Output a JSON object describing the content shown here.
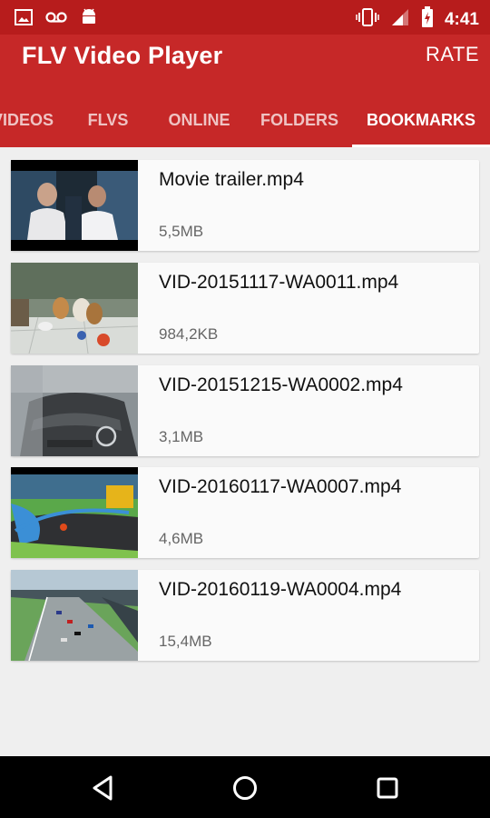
{
  "status_bar": {
    "time": "4:41",
    "left_icons": [
      "image-icon",
      "voicemail-icon",
      "android-icon"
    ],
    "right_icons": [
      "vibrate-icon",
      "signal-icon",
      "battery-charging-icon"
    ]
  },
  "app_bar": {
    "title": "FLV Video Player",
    "action_label": "RATE"
  },
  "tabs": [
    {
      "label": "VIDEOS",
      "active": false
    },
    {
      "label": "FLVS",
      "active": false
    },
    {
      "label": "ONLINE",
      "active": false
    },
    {
      "label": "FOLDERS",
      "active": false
    },
    {
      "label": "BOOKMARKS",
      "active": true
    }
  ],
  "videos": [
    {
      "name": "Movie trailer.mp4",
      "size": "5,5MB"
    },
    {
      "name": "VID-20151117-WA0011.mp4",
      "size": "984,2KB"
    },
    {
      "name": "VID-20151215-WA0002.mp4",
      "size": "3,1MB"
    },
    {
      "name": "VID-20160117-WA0007.mp4",
      "size": "4,6MB"
    },
    {
      "name": "VID-20160119-WA0004.mp4",
      "size": "15,4MB"
    }
  ],
  "nav_bar": [
    "back-icon",
    "home-icon",
    "recents-icon"
  ],
  "colors": {
    "status_bar": "#b71c1c",
    "app_bar": "#c62828",
    "background": "#efefef"
  }
}
